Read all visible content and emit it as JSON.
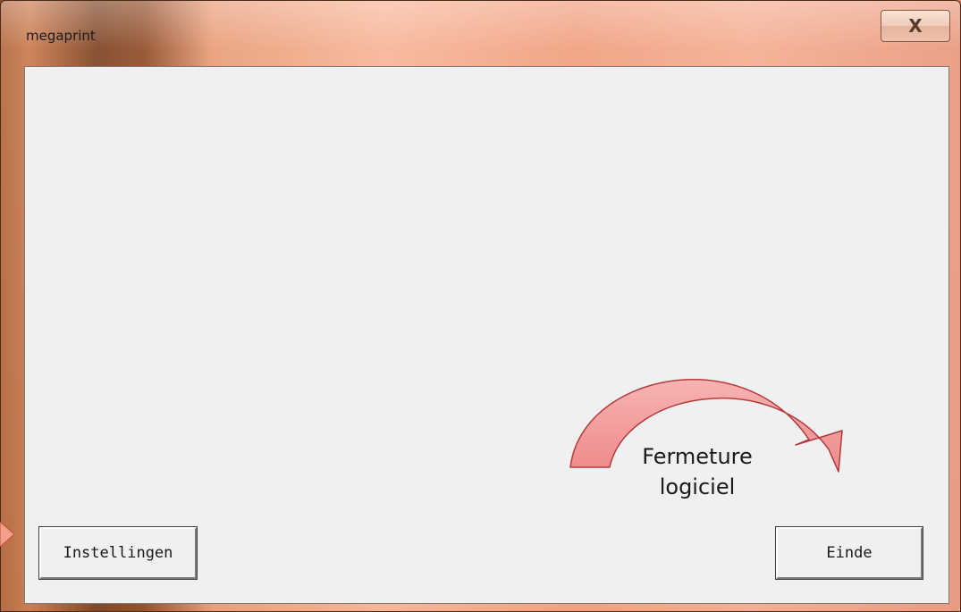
{
  "window": {
    "title": "megaprint",
    "close_glyph": "X"
  },
  "buttons": {
    "settings_label": "Instellingen",
    "end_label": "Einde"
  },
  "annotation": {
    "line1": "Fermeture",
    "line2": "logiciel",
    "arrow_color": "#f28b8b"
  },
  "colors": {
    "client_bg": "#f0f0f0",
    "frame_accent": "#f4ab8d"
  }
}
